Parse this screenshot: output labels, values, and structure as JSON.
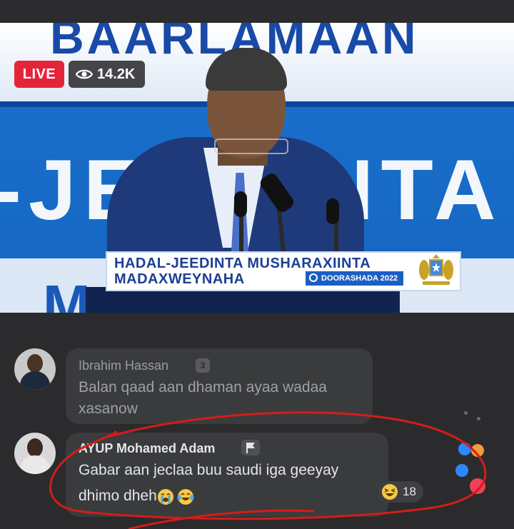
{
  "video": {
    "live_label": "LIVE",
    "viewer_count": "14.2K",
    "banner_top": "BAARLAMAAN",
    "banner_mid": "-JEEDINTA",
    "banner_low": "MAA",
    "lower_third_line1": "HADAL-JEEDINTA MUSHARAXIINTA",
    "lower_third_line2": "MADAXWEYNAHA",
    "badge_text": "DOORASHADA 2022",
    "colors": {
      "live": "#e42539",
      "banner_blue": "#1a73cf",
      "caption_blue": "#1c3f94"
    }
  },
  "comments": [
    {
      "author": "Ibrahim Hassan",
      "badge": "3",
      "text_line1": "Balan qaad aan dhaman ayaa wadaa",
      "text_line2": "xasanow",
      "icons": [
        "avatar",
        "rank-badge-icon"
      ]
    },
    {
      "author": "AYUP Mohamed Adam",
      "text_line1": "Gabar aan jeclaa buu saudi iga geeyay",
      "text_line2": "dhimo dheh",
      "reaction_count": "18",
      "icons": [
        "avatar",
        "flag-icon",
        "crying-emoji-icon",
        "tears-of-joy-emoji-icon",
        "laughing-reaction-icon"
      ]
    }
  ],
  "floating_reactions": [
    "like-icon",
    "angry-icon",
    "like-icon",
    "love-icon"
  ]
}
